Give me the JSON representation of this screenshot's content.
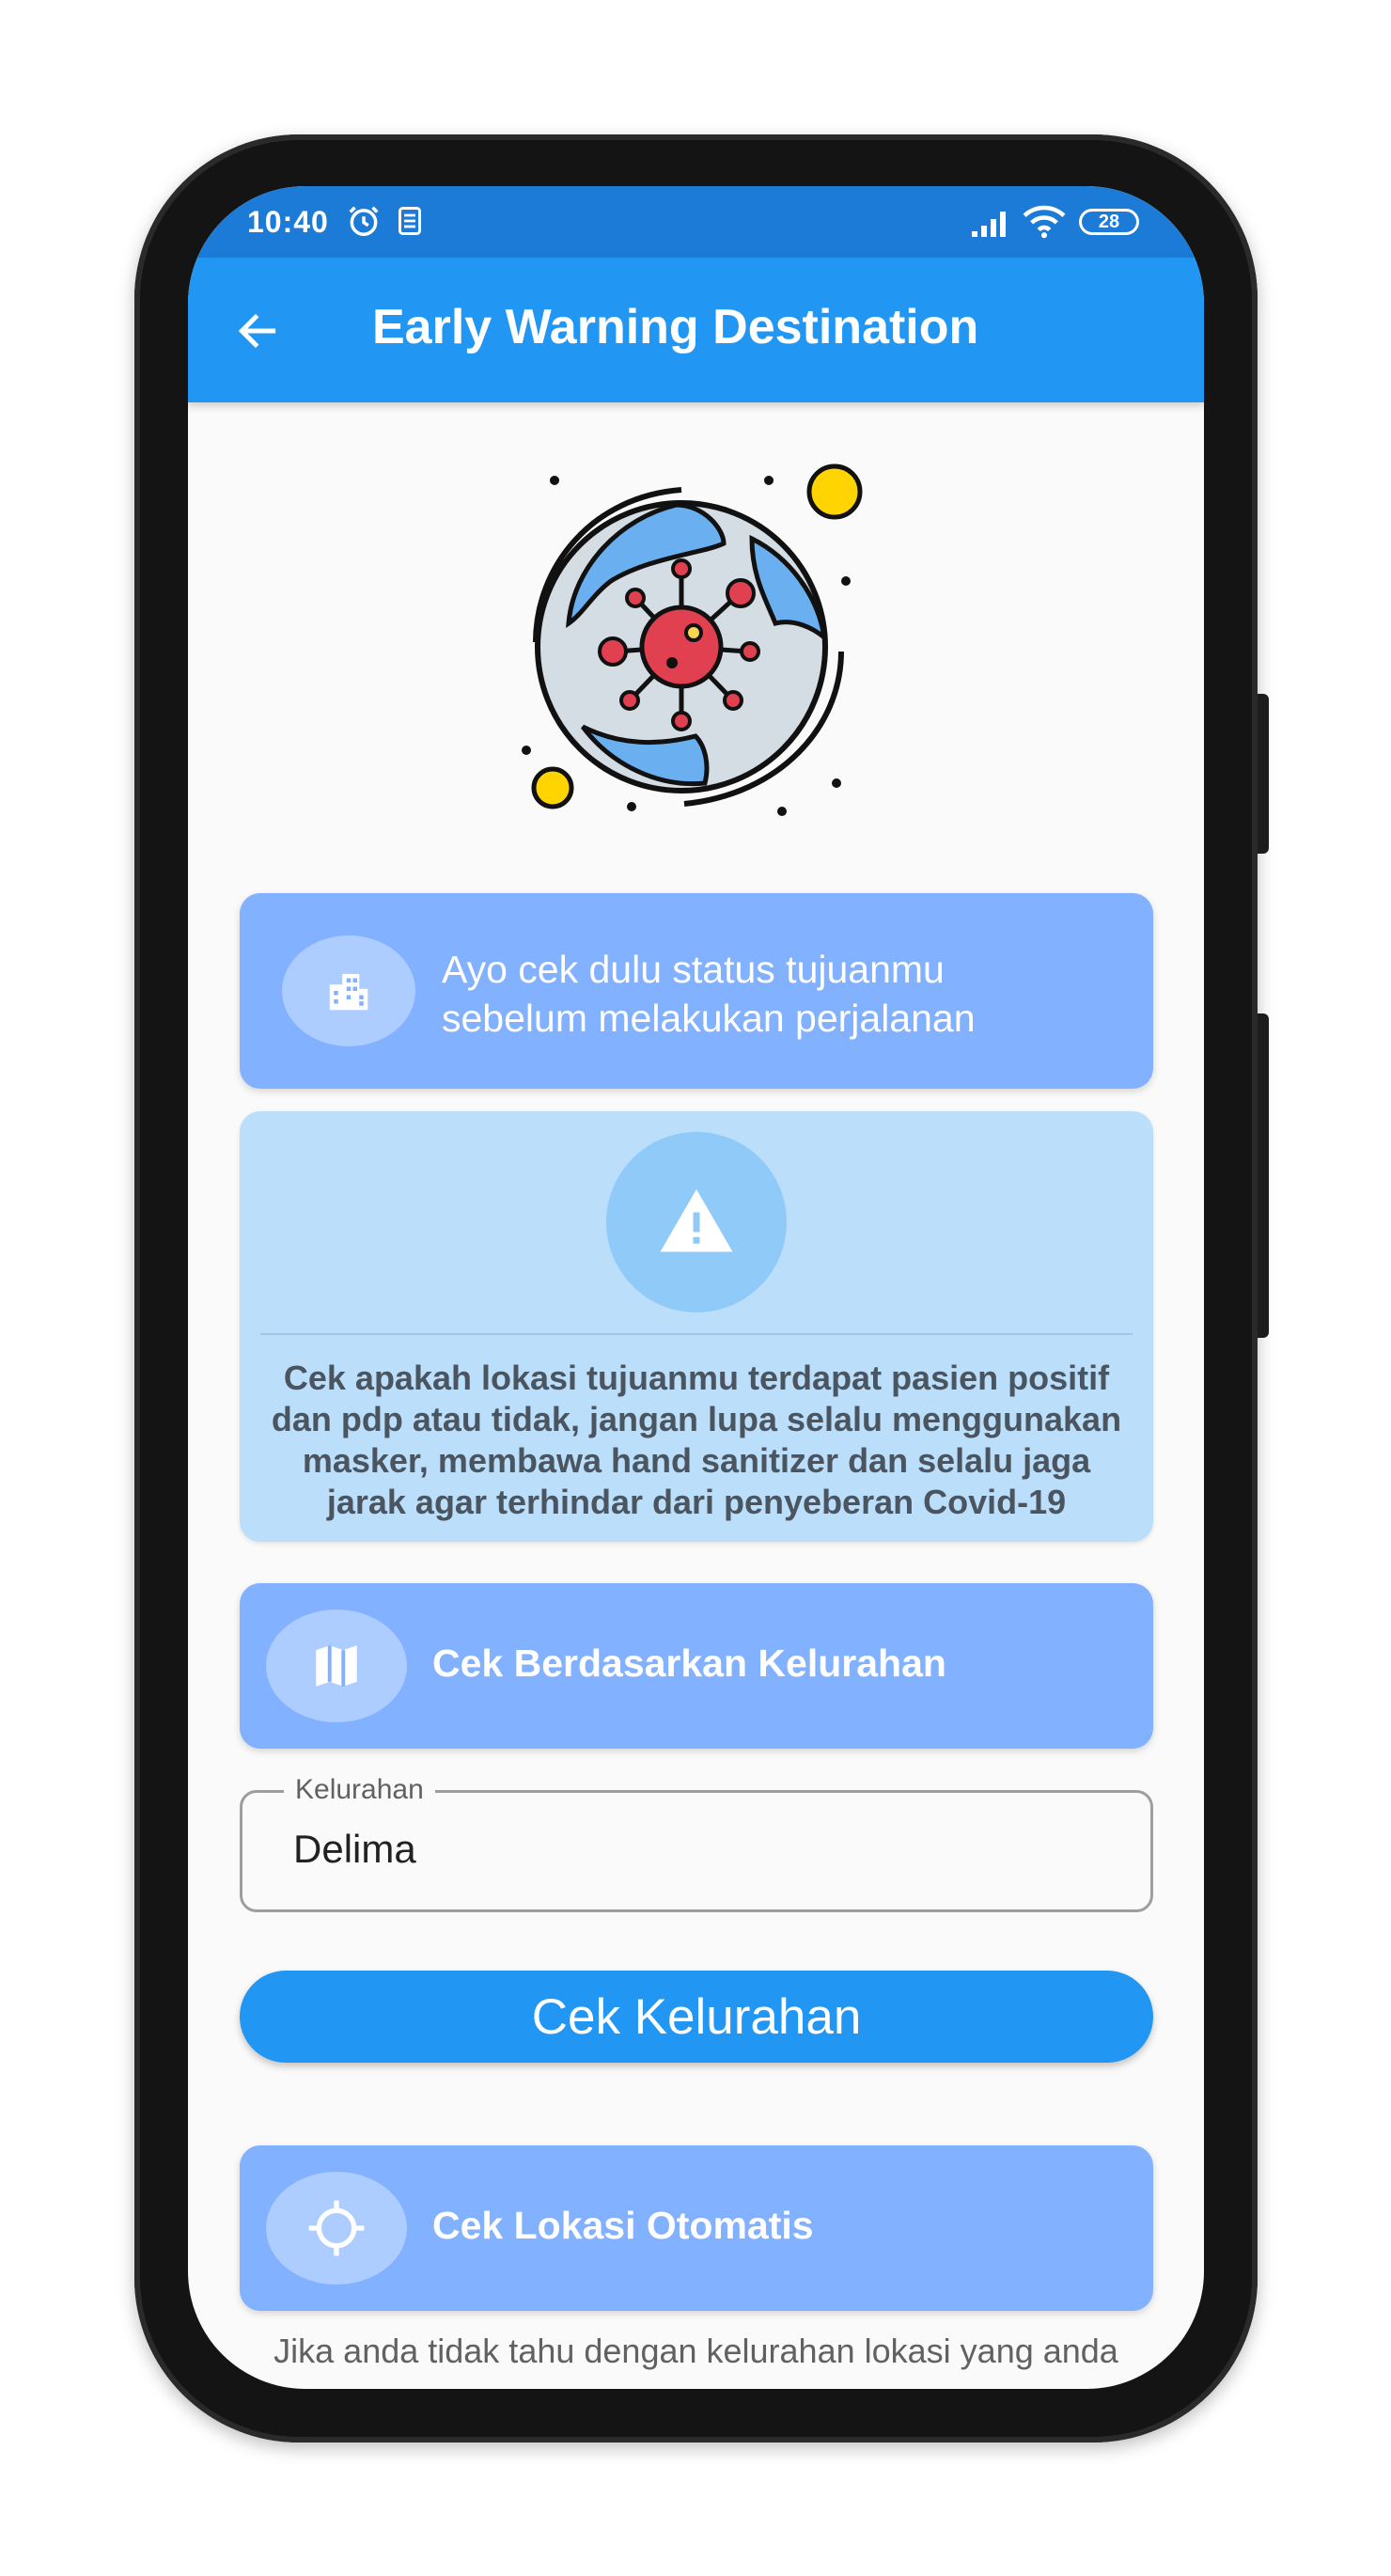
{
  "status_bar": {
    "time": "10:40",
    "battery": "28",
    "icons": [
      "alarm-icon",
      "note-icon",
      "signal-icon",
      "wifi-icon",
      "battery-icon"
    ]
  },
  "app_bar": {
    "title": "Early Warning Destination",
    "back_icon": "arrow-left-icon"
  },
  "hero": {
    "icon": "globe-virus-illustration"
  },
  "intro_card": {
    "line1": "Ayo cek dulu status tujuanmu",
    "line2": "sebelum melakukan perjalanan",
    "icon": "city-icon"
  },
  "warning_card": {
    "icon": "warning-triangle-icon",
    "text": "Cek apakah lokasi tujuanmu terdapat pasien positif dan pdp atau tidak, jangan lupa selalu menggunakan masker, membawa hand sanitizer dan selalu jaga jarak agar terhindar dari penyeberan Covid-19"
  },
  "kelurahan_section": {
    "label": "Cek Berdasarkan Kelurahan",
    "icon": "map-icon"
  },
  "kelurahan_field": {
    "label": "Kelurahan",
    "value": "Delima"
  },
  "check_button": {
    "label": "Cek Kelurahan"
  },
  "auto_section": {
    "label": "Cek Lokasi Otomatis",
    "icon": "gps-crosshair-icon"
  },
  "footnote": {
    "text": "Jika anda tidak tahu dengan kelurahan lokasi yang anda"
  },
  "colors": {
    "status_bar": "#1c7bd6",
    "app_bar": "#2196f3",
    "card_blue": "#82b1ff",
    "card_light": "#bbdefb",
    "button": "#2196f3"
  }
}
